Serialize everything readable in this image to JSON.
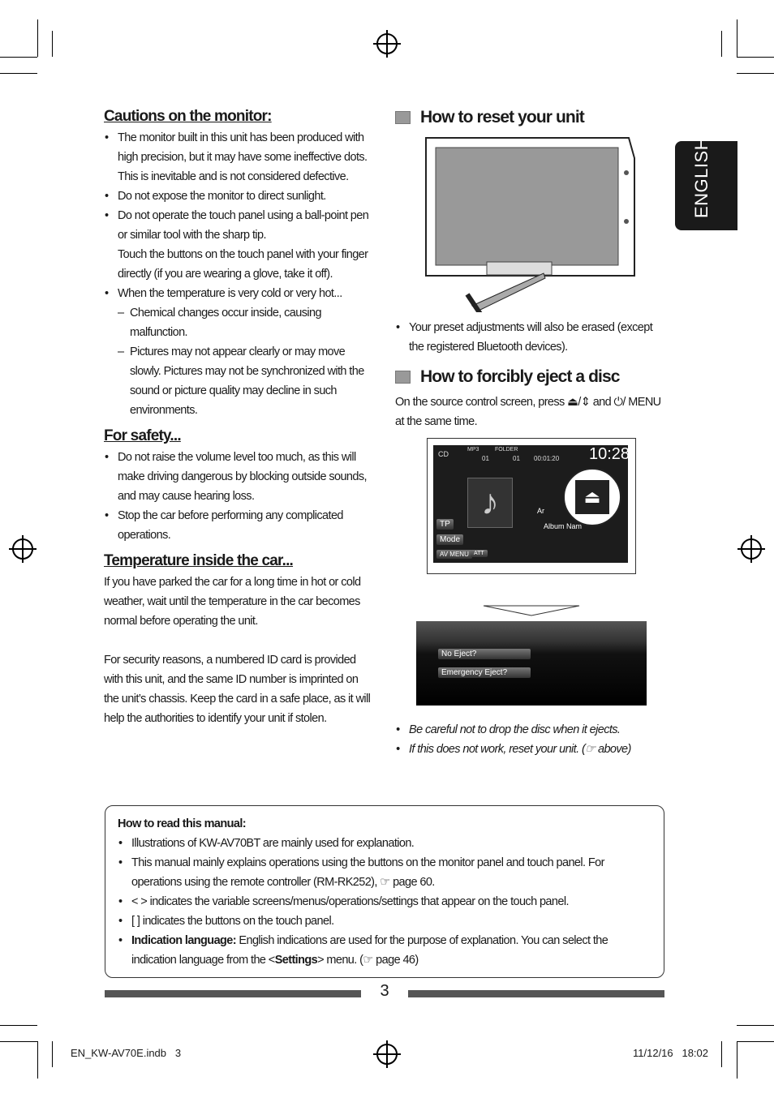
{
  "language_tab": "ENGLISH",
  "cautions": {
    "title": "Cautions on the monitor:",
    "items": [
      "The monitor built in this unit has been produced with high precision, but it may have some ineffective dots. This is inevitable and is not considered defective.",
      "Do not expose the monitor to direct sunlight.",
      "Do not operate the touch panel using a ball-point pen or similar tool with the sharp tip.",
      "Touch the buttons on the touch panel with your finger directly (if you are wearing a glove, take it off).",
      "When the temperature is very cold or very hot..."
    ],
    "sub_items": [
      "Chemical changes occur inside, causing malfunction.",
      "Pictures may not appear clearly or may move slowly. Pictures may not be synchronized with the sound or picture quality may decline in such environments."
    ]
  },
  "safety": {
    "title": "For safety...",
    "items": [
      "Do not raise the volume level too much, as this will make driving dangerous by blocking outside sounds, and may cause hearing loss.",
      "Stop the car before performing any complicated operations."
    ]
  },
  "temperature": {
    "title": "Temperature inside the car...",
    "text": "If you have parked the car for a long time in hot or cold weather, wait until the temperature in the car becomes normal before operating the unit.",
    "security": "For security reasons, a numbered ID card is provided with this unit, and the same ID number is imprinted on the unit’s chassis. Keep the card in a safe place, as it will help the authorities to identify your unit if stolen."
  },
  "reset": {
    "title": "How to reset your unit",
    "note": "Your preset adjustments will also be erased (except the registered Bluetooth devices)."
  },
  "eject": {
    "title": "How to forcibly eject a disc",
    "text1": "On the source control screen, press",
    "text2": "and",
    "text3": "/ MENU at the same time.",
    "screen": {
      "source": "CD",
      "format": "MP3",
      "folder": "FOLDER",
      "folder_no": "01",
      "track_no": "01",
      "time": "00:01:20",
      "clock": "10:28",
      "artist": "Ar",
      "album": "Album Nam",
      "mode": "Mode",
      "av_menu": "AV MENU",
      "att": "ATT",
      "tp": "TP"
    },
    "menu": [
      "No Eject?",
      "Emergency Eject?"
    ],
    "notes": [
      "Be careful not to drop the disc when it ejects.",
      "If this does not work, reset your unit. (☞ above)"
    ]
  },
  "manual": {
    "title": "How to read this manual:",
    "items": [
      "Illustrations of KW-AV70BT are mainly used for explanation.",
      "This manual mainly explains operations using the buttons on the monitor panel and touch panel. For operations using the remote controller (RM-RK252), ☞ page 60.",
      "< > indicates the variable screens/menus/operations/settings that appear on the touch panel.",
      "[ ] indicates the buttons on the touch panel."
    ],
    "lang_label": "Indication language:",
    "lang_text1": "English indications are used for the purpose of explanation. You can select the indication language from the <",
    "lang_bold": "Settings",
    "lang_text2": "> menu. (☞ page 46)"
  },
  "page_number": "3",
  "footer": {
    "file": "EN_KW-AV70E.indb   3",
    "date": "11/12/16   18:02"
  }
}
